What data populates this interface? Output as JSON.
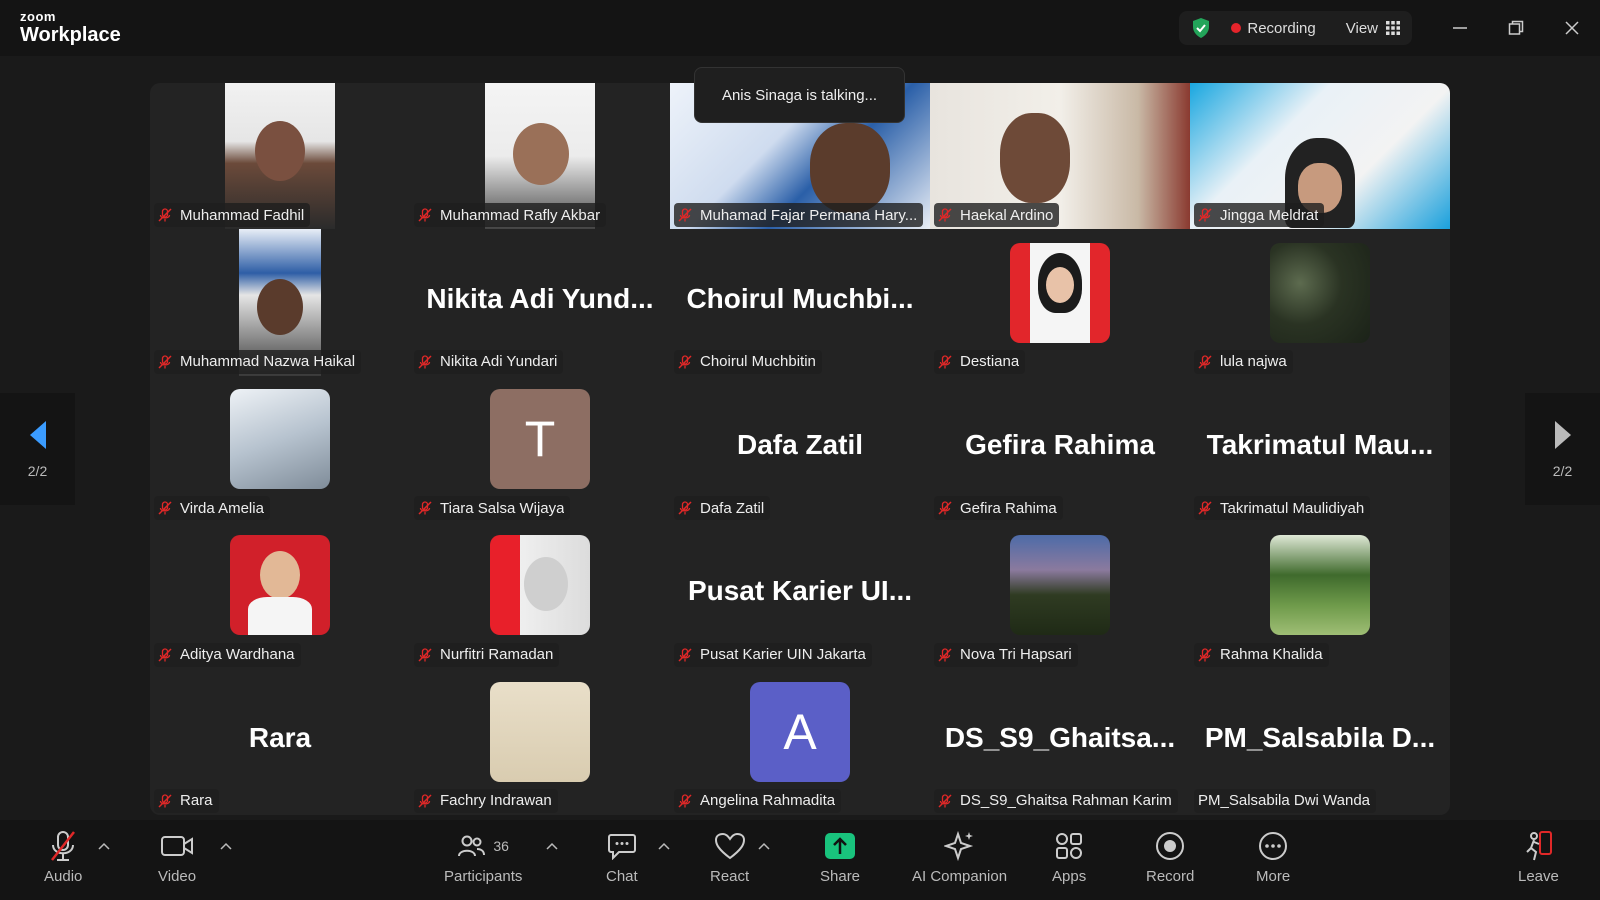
{
  "app": {
    "brand_small": "zoom",
    "brand_large": "Workplace"
  },
  "status": {
    "recording_label": "Recording",
    "view_label": "View"
  },
  "talking_indicator": "Anis Sinaga is talking...",
  "pager": {
    "left_label": "2/2",
    "right_label": "2/2"
  },
  "participants": [
    {
      "name": "Muhammad Fadhil",
      "display": "video"
    },
    {
      "name": "Muhammad Rafly Akbar",
      "display": "video"
    },
    {
      "name": "Muhamad Fajar Permana Hary...",
      "display": "video"
    },
    {
      "name": "Haekal Ardino",
      "display": "video"
    },
    {
      "name": "Jingga Meldrat",
      "display": "video"
    },
    {
      "name": "Muhammad Nazwa Haikal",
      "display": "video"
    },
    {
      "name": "Nikita Adi Yundari",
      "display": "name",
      "big": "Nikita Adi Yund..."
    },
    {
      "name": "Choirul Muchbitin",
      "display": "name",
      "big": "Choirul  Muchbi..."
    },
    {
      "name": "Destiana",
      "display": "avatar"
    },
    {
      "name": "lula najwa",
      "display": "avatar"
    },
    {
      "name": "Virda Amelia",
      "display": "avatar"
    },
    {
      "name": "Tiara Salsa Wijaya",
      "display": "letter",
      "letter": "T",
      "color": "#8d6e63"
    },
    {
      "name": "Dafa Zatil",
      "display": "name",
      "big": "Dafa Zatil"
    },
    {
      "name": "Gefira Rahima",
      "display": "name",
      "big": "Gefira Rahima"
    },
    {
      "name": "Takrimatul Maulidiyah",
      "display": "name",
      "big": "Takrimatul  Mau..."
    },
    {
      "name": "Aditya Wardhana",
      "display": "avatar"
    },
    {
      "name": "Nurfitri Ramadan",
      "display": "avatar"
    },
    {
      "name": "Pusat Karier UIN Jakarta",
      "display": "name",
      "big": "Pusat  Karier  UI..."
    },
    {
      "name": "Nova Tri Hapsari",
      "display": "avatar"
    },
    {
      "name": "Rahma Khalida",
      "display": "avatar"
    },
    {
      "name": "Rara",
      "display": "name",
      "big": "Rara"
    },
    {
      "name": "Fachry Indrawan",
      "display": "avatar"
    },
    {
      "name": "Angelina Rahmadita",
      "display": "letter",
      "letter": "A",
      "color": "#5b5fc7"
    },
    {
      "name": "DS_S9_Ghaitsa Rahman Karim",
      "display": "name",
      "big": "DS_S9_Ghaitsa..."
    },
    {
      "name": "PM_Salsabila Dwi Wanda",
      "display": "name",
      "big": "PM_Salsabila  D...",
      "unmuted": true
    }
  ],
  "toolbar": {
    "audio": "Audio",
    "video": "Video",
    "participants": "Participants",
    "participants_count": "36",
    "chat": "Chat",
    "react": "React",
    "share": "Share",
    "ai_companion": "AI Companion",
    "apps": "Apps",
    "record": "Record",
    "more": "More",
    "leave": "Leave"
  },
  "colors": {
    "share_green": "#19c37d",
    "recording_red": "#e5242b",
    "shield_green": "#23a55a",
    "muted_red": "#e02828",
    "pager_blue": "#3b9cff"
  }
}
